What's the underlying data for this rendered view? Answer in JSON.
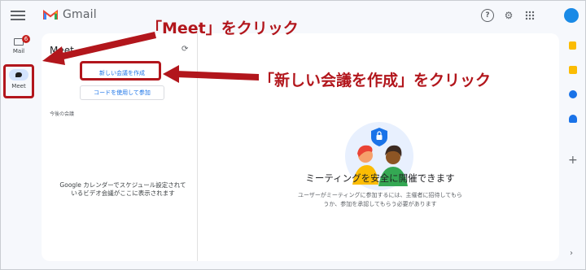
{
  "header": {
    "app_name": "Gmail",
    "icons": [
      "menu-icon",
      "gmail-logo-icon",
      "help-icon",
      "settings-icon",
      "apps-grid-icon",
      "account-avatar-icon"
    ]
  },
  "rail": {
    "mail_label": "Mail",
    "mail_badge": "6",
    "meet_label": "Meet"
  },
  "meet_panel": {
    "title": "Meet",
    "new_meeting_button": "新しい会議を作成",
    "use_code_button": "コードを使用して参加",
    "upcoming_heading": "今後の会議",
    "calendar_note": "Google カレンダーでスケジュール設定されているビデオ会議がここに表示されます",
    "headline": "ミーティングを安全に開催できます",
    "subtext": "ユーザーがミーティングに参加するには、主催者に招待してもらうか、参加を承認してもらう必要があります"
  },
  "annotations": {
    "click_meet": "「Meet」をクリック",
    "click_new_meeting": "「新しい会議を作成」をクリック"
  },
  "colors": {
    "annotation_red": "#b2161c",
    "link_blue": "#1a73e8",
    "avatar_blue": "#1a8ae6"
  }
}
